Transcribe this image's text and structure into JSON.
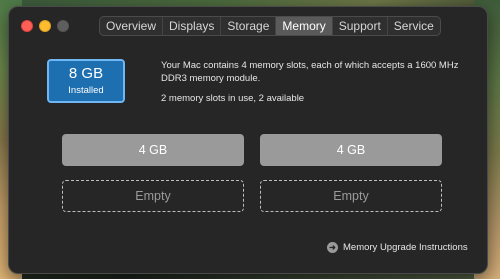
{
  "window": {
    "tabs": [
      {
        "label": "Overview",
        "active": false
      },
      {
        "label": "Displays",
        "active": false
      },
      {
        "label": "Storage",
        "active": false
      },
      {
        "label": "Memory",
        "active": true
      },
      {
        "label": "Support",
        "active": false
      },
      {
        "label": "Service",
        "active": false
      }
    ]
  },
  "memory": {
    "capacity": "8 GB",
    "capacity_label": "Installed",
    "description": "Your Mac contains 4 memory slots, each of which accepts a 1600 MHz DDR3 memory module.",
    "slots_status": "2 memory slots in use, 2 available",
    "slots": [
      {
        "label": "4 GB",
        "state": "filled"
      },
      {
        "label": "4 GB",
        "state": "filled"
      },
      {
        "label": "Empty",
        "state": "empty"
      },
      {
        "label": "Empty",
        "state": "empty"
      }
    ],
    "upgrade_link": "Memory Upgrade Instructions",
    "upgrade_icon": "arrow-right-circle-icon"
  },
  "colors": {
    "accent": "#1e6fb0",
    "close": "#fe5f57",
    "minimize": "#febc2e"
  }
}
